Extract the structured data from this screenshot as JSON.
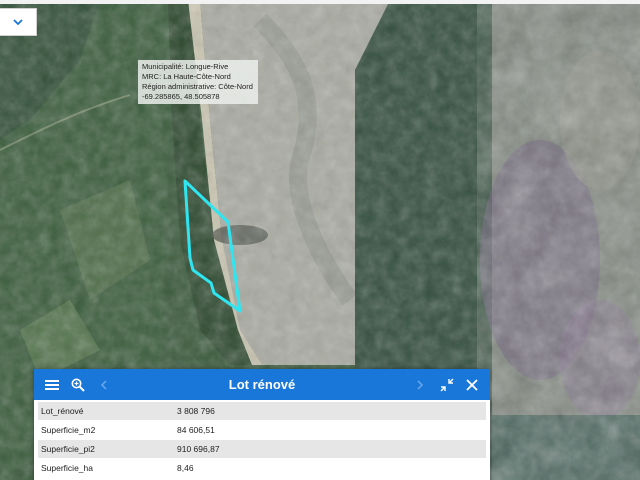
{
  "map": {
    "label_lines": [
      "Municipalité: Longue-Rive",
      "MRC: La Haute-Côte-Nord",
      "Région administrative: Côte-Nord",
      "-69.285865, 48.505878"
    ],
    "colors": {
      "parcel_outline": "#2fe6f0",
      "header": "#1877d9"
    }
  },
  "popup": {
    "title": "Lot rénové",
    "rows": [
      {
        "key": "Lot_rénové",
        "value": "3 808 796"
      },
      {
        "key": "Superficie_m2",
        "value": "84 606,51"
      },
      {
        "key": "Superficie_pi2",
        "value": "910 696,87"
      },
      {
        "key": "Superficie_ha",
        "value": "8,46"
      }
    ],
    "icons": [
      "menu-icon",
      "zoom-to-icon",
      "previous-icon",
      "next-icon",
      "dock-icon",
      "close-icon"
    ]
  },
  "dropdown": {
    "icon": "chevron-down-icon"
  }
}
